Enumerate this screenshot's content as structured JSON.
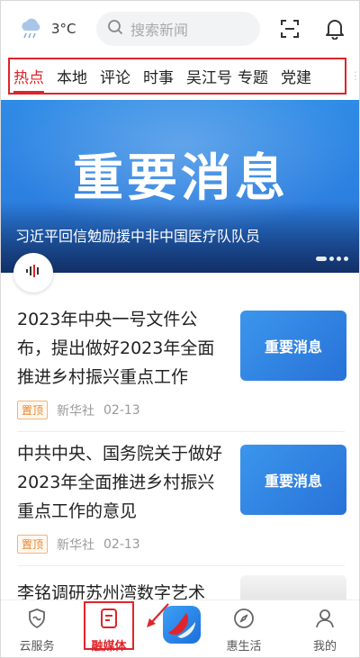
{
  "header": {
    "weather_icon": "cloud-rain-icon",
    "temperature": "3°C",
    "search_placeholder": "搜索新闻",
    "scan_icon": "scan-icon",
    "bell_icon": "bell-icon"
  },
  "tabs": [
    "热点",
    "本地",
    "评论",
    "时事",
    "吴江号",
    "专题",
    "党建"
  ],
  "banner": {
    "title": "重要消息",
    "caption": "习近平回信勉励援中非中国医疗队队员"
  },
  "news": [
    {
      "title": "2023年中央一号文件公布，提出做好2023年全面推进乡村振兴重点工作",
      "thumb_text": "重要消息",
      "badge": "置顶",
      "source": "新华社",
      "date": "02-13"
    },
    {
      "title": "中共中央、国务院关于做好2023年全面推进乡村振兴重点工作的意见",
      "thumb_text": "重要消息",
      "badge": "置顶",
      "source": "新华社",
      "date": "02-13"
    },
    {
      "title": "李铭调研苏州湾数字艺术"
    }
  ],
  "bottom_nav": [
    {
      "label": "云服务",
      "icon": "shield-icon"
    },
    {
      "label": "融媒体",
      "icon": "document-icon"
    },
    {
      "label": "",
      "icon": "app-logo-icon"
    },
    {
      "label": "惠生活",
      "icon": "compass-icon"
    },
    {
      "label": "我的",
      "icon": "person-icon"
    }
  ],
  "colors": {
    "accent": "#e0242b",
    "banner_blue": "#2c7fe0"
  }
}
